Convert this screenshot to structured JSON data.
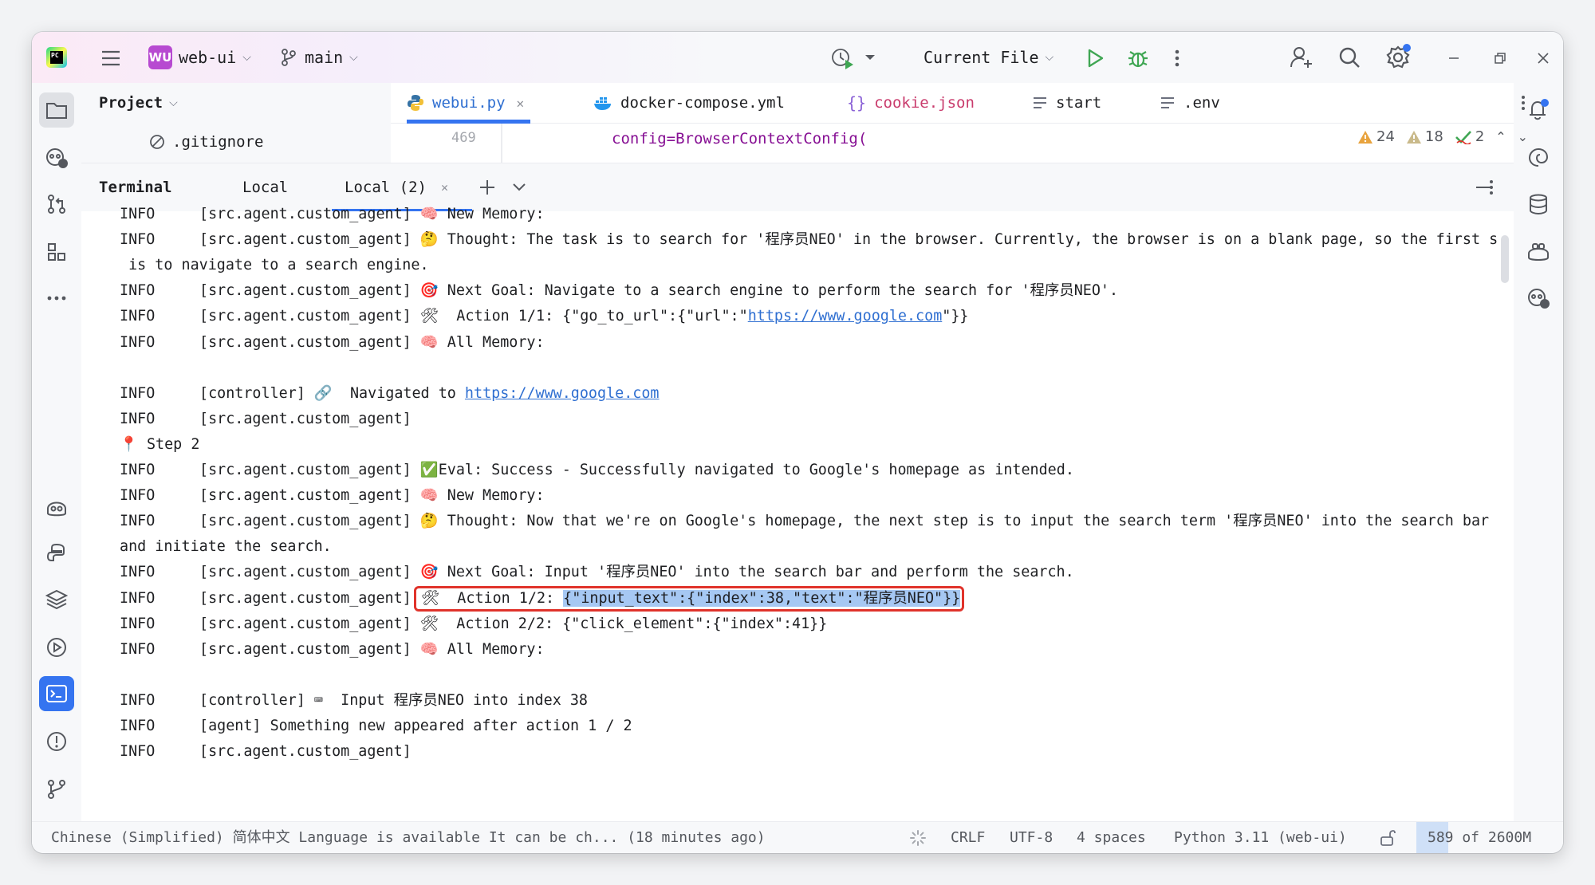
{
  "titlebar": {
    "project_badge": "WU",
    "project_name": "web-ui",
    "branch": "main",
    "run_config": "Current File"
  },
  "project_panel": {
    "title": "Project",
    "file": ".gitignore"
  },
  "editor": {
    "tabs": [
      {
        "label": "webui.py",
        "icon": "python-icon",
        "active": true
      },
      {
        "label": "docker-compose.yml",
        "icon": "docker-icon",
        "active": false
      },
      {
        "label": "cookie.json",
        "icon": "json-braces-icon",
        "active": false
      },
      {
        "label": "start",
        "icon": "text-file-icon",
        "active": false
      },
      {
        "label": ".env",
        "icon": "text-file-icon",
        "active": false
      }
    ],
    "line_number": "469",
    "code_line": "config=BrowserContextConfig(",
    "warnings_count": "24",
    "weak_warnings_count": "18",
    "checks_count": "2"
  },
  "terminal": {
    "title": "Terminal",
    "tabs": [
      "Local",
      "Local (2)"
    ],
    "lines": [
      {
        "level": "INFO",
        "text": "[src.agent.custom_agent] 🧠 New Memory:"
      },
      {
        "level": "INFO",
        "text": "[src.agent.custom_agent] 🤔 Thought: The task is to search for '程序员NEO' in the browser. Currently, the browser is on a blank page, so the first s"
      },
      {
        "level": "",
        "text": " is to navigate to a search engine."
      },
      {
        "level": "INFO",
        "text": "[src.agent.custom_agent] 🎯 Next Goal: Navigate to a search engine to perform the search for '程序员NEO'."
      },
      {
        "level": "INFO",
        "text_before": "[src.agent.custom_agent] 🛠  Action 1/1: {\"go_to_url\":{\"url\":\"",
        "link": "https://www.google.com",
        "text_after": "\"}}"
      },
      {
        "level": "INFO",
        "text": "[src.agent.custom_agent] 🧠 All Memory:"
      },
      {
        "level": "",
        "text": ""
      },
      {
        "level": "INFO",
        "text_before": "[controller] 🔗  Navigated to ",
        "link": "https://www.google.com",
        "text_after": ""
      },
      {
        "level": "INFO",
        "text": "[src.agent.custom_agent]"
      },
      {
        "level": "",
        "text": "📍 Step 2"
      },
      {
        "level": "INFO",
        "text": "[src.agent.custom_agent] ✅Eval: Success - Successfully navigated to Google's homepage as intended."
      },
      {
        "level": "INFO",
        "text": "[src.agent.custom_agent] 🧠 New Memory:"
      },
      {
        "level": "INFO",
        "text": "[src.agent.custom_agent] 🤔 Thought: Now that we're on Google's homepage, the next step is to input the search term '程序员NEO' into the search bar"
      },
      {
        "level": "",
        "text": "and initiate the search."
      },
      {
        "level": "INFO",
        "text": "[src.agent.custom_agent] 🎯 Next Goal: Input '程序员NEO' into the search bar and perform the search."
      },
      {
        "level": "INFO",
        "text_before": "[src.agent.custom_agent] ",
        "highlight_prefix": "🛠  Action 1/2: ",
        "selected": "{\"input_text\":{\"index\":38,\"text\":\"程序员NEO\"}}"
      },
      {
        "level": "INFO",
        "text": "[src.agent.custom_agent] 🛠  Action 2/2: {\"click_element\":{\"index\":41}}"
      },
      {
        "level": "INFO",
        "text": "[src.agent.custom_agent] 🧠 All Memory:"
      },
      {
        "level": "",
        "text": ""
      },
      {
        "level": "INFO",
        "text": "[controller] ⌨  Input 程序员NEO into index 38"
      },
      {
        "level": "INFO",
        "text": "[agent] Something new appeared after action 1 / 2"
      },
      {
        "level": "INFO",
        "text": "[src.agent.custom_agent]"
      }
    ]
  },
  "statusbar": {
    "notification": "Chinese (Simplified) 简体中文 Language is available It can be ch... (18 minutes ago)",
    "line_sep": "CRLF",
    "encoding": "UTF-8",
    "indent": "4 spaces",
    "interpreter": "Python 3.11 (web-ui)",
    "memory": "589 of 2600M"
  },
  "colors": {
    "accent": "#3574f0",
    "highlight_border": "#e0332b",
    "selection": "#a6c8f3",
    "link": "#2f6fd1"
  }
}
